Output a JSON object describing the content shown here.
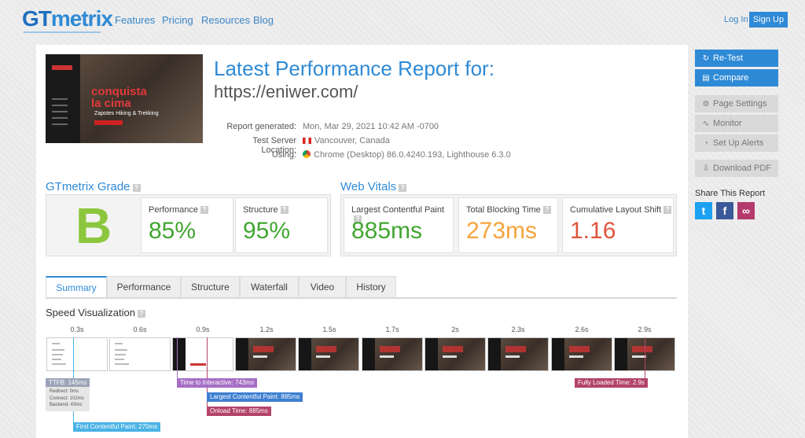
{
  "brand": {
    "name_prefix": "GT",
    "name_suffix": "metrix"
  },
  "nav": {
    "features": "Features",
    "pricing": "Pricing",
    "resources": "Resources",
    "blog": "Blog",
    "login": "Log In",
    "signup": "Sign Up"
  },
  "report": {
    "title": "Latest Performance Report for:",
    "url": "https://eniwer.com/",
    "generated_label": "Report generated:",
    "generated_value": "Mon, Mar 29, 2021 10:42 AM -0700",
    "server_label": "Test Server Location:",
    "server_value": "Vancouver, Canada",
    "using_label": "Using:",
    "using_value": "Chrome (Desktop) 86.0.4240.193, Lighthouse 6.3.0"
  },
  "thumbnail": {
    "headline": "conquista la cima",
    "subline": "Zapotes Hiking & Trekking"
  },
  "grade": {
    "title": "GTmetrix Grade",
    "letter": "B",
    "performance_label": "Performance",
    "performance_value": "85%",
    "structure_label": "Structure",
    "structure_value": "95%"
  },
  "vitals": {
    "title": "Web Vitals",
    "lcp_label": "Largest Contentful Paint",
    "lcp_value": "885ms",
    "tbt_label": "Total Blocking Time",
    "tbt_value": "273ms",
    "cls_label": "Cumulative Layout Shift",
    "cls_value": "1.16"
  },
  "tabs": [
    "Summary",
    "Performance",
    "Structure",
    "Waterfall",
    "Video",
    "History"
  ],
  "speed": {
    "title": "Speed Visualization",
    "ticks": [
      "0.3s",
      "0.6s",
      "0.9s",
      "1.2s",
      "1.5s",
      "1.7s",
      "2s",
      "2.3s",
      "2.6s",
      "2.9s"
    ],
    "ttfb": "TTFB: 145ms",
    "redirect": "Redirect: 0ms",
    "connect": "Connect: 102ms",
    "backend": "Backend: 43ms",
    "fcp": "First Contentful Paint: 270ms",
    "tti": "Time to Interactive: 743ms",
    "lcp": "Largest Contentful Paint: 885ms",
    "onload": "Onload Time: 885ms",
    "fully_loaded": "Fully Loaded Time: 2.9s"
  },
  "sidebar": {
    "retest": "Re-Test",
    "compare": "Compare",
    "page_settings": "Page Settings",
    "monitor": "Monitor",
    "alerts": "Set Up Alerts",
    "pdf": "Download PDF",
    "share_title": "Share This Report"
  },
  "colors": {
    "accent": "#2f8ad6",
    "grade_b": "#8cc63f",
    "good": "#41a630",
    "avg": "#f5a33b",
    "poor": "#e0533c"
  }
}
